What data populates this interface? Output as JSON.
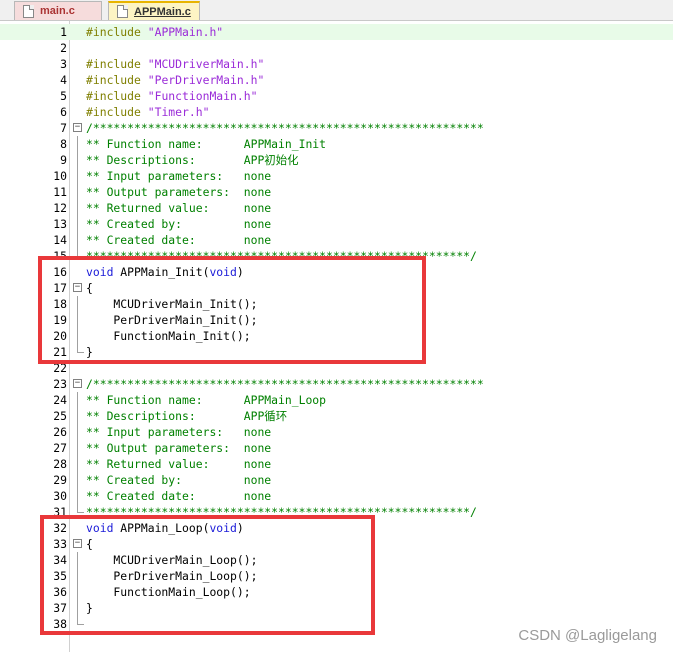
{
  "tabs": [
    {
      "label": "main.c",
      "active": false
    },
    {
      "label": "APPMain.c",
      "active": true
    }
  ],
  "lines": [
    {
      "n": "1",
      "html": "<span class=\"c-pre\">#include</span> <span class=\"c-str\">\"APPMain.h\"</span>",
      "hl": true
    },
    {
      "n": "2",
      "html": ""
    },
    {
      "n": "3",
      "html": "<span class=\"c-pre\">#include</span> <span class=\"c-str\">\"MCUDriverMain.h\"</span>"
    },
    {
      "n": "4",
      "html": "<span class=\"c-pre\">#include</span> <span class=\"c-str\">\"PerDriverMain.h\"</span>"
    },
    {
      "n": "5",
      "html": "<span class=\"c-pre\">#include</span> <span class=\"c-str\">\"FunctionMain.h\"</span>"
    },
    {
      "n": "6",
      "html": "<span class=\"c-pre\">#include</span> <span class=\"c-str\">\"Timer.h\"</span>"
    },
    {
      "n": "7",
      "html": "<span class=\"c-com\">/*********************************************************</span>",
      "fold": "open"
    },
    {
      "n": "8",
      "html": "<span class=\"c-com\">** Function name:      APPMain_Init</span>",
      "guide": true
    },
    {
      "n": "9",
      "html": "<span class=\"c-com\">** Descriptions:       APP初始化</span>",
      "guide": true
    },
    {
      "n": "10",
      "html": "<span class=\"c-com\">** Input parameters:   none</span>",
      "guide": true
    },
    {
      "n": "11",
      "html": "<span class=\"c-com\">** Output parameters:  none</span>",
      "guide": true
    },
    {
      "n": "12",
      "html": "<span class=\"c-com\">** Returned value:     none</span>",
      "guide": true
    },
    {
      "n": "13",
      "html": "<span class=\"c-com\">** Created by:         none</span>",
      "guide": true
    },
    {
      "n": "14",
      "html": "<span class=\"c-com\">** Created date:       none</span>",
      "guide": true
    },
    {
      "n": "15",
      "html": "<span class=\"c-com\">********************************************************/</span>",
      "guideEnd": true
    },
    {
      "n": "16",
      "html": "<span class=\"c-kw\">void</span> APPMain_Init(<span class=\"c-kw\">void</span>)"
    },
    {
      "n": "17",
      "html": "{",
      "fold": "open"
    },
    {
      "n": "18",
      "html": "    MCUDriverMain_Init();",
      "guide": true
    },
    {
      "n": "19",
      "html": "    PerDriverMain_Init();",
      "guide": true
    },
    {
      "n": "20",
      "html": "    FunctionMain_Init();",
      "guide": true
    },
    {
      "n": "21",
      "html": "}",
      "guideEnd": true
    },
    {
      "n": "22",
      "html": ""
    },
    {
      "n": "23",
      "html": "<span class=\"c-com\">/*********************************************************</span>",
      "fold": "open"
    },
    {
      "n": "24",
      "html": "<span class=\"c-com\">** Function name:      APPMain_Loop</span>",
      "guide": true
    },
    {
      "n": "25",
      "html": "<span class=\"c-com\">** Descriptions:       APP循环</span>",
      "guide": true
    },
    {
      "n": "26",
      "html": "<span class=\"c-com\">** Input parameters:   none</span>",
      "guide": true
    },
    {
      "n": "27",
      "html": "<span class=\"c-com\">** Output parameters:  none</span>",
      "guide": true
    },
    {
      "n": "28",
      "html": "<span class=\"c-com\">** Returned value:     none</span>",
      "guide": true
    },
    {
      "n": "29",
      "html": "<span class=\"c-com\">** Created by:         none</span>",
      "guide": true
    },
    {
      "n": "30",
      "html": "<span class=\"c-com\">** Created date:       none</span>",
      "guide": true
    },
    {
      "n": "31",
      "html": "<span class=\"c-com\">********************************************************/</span>",
      "guideEnd": true
    },
    {
      "n": "32",
      "html": "<span class=\"c-kw\">void</span> APPMain_Loop(<span class=\"c-kw\">void</span>)"
    },
    {
      "n": "33",
      "html": "{",
      "fold": "open"
    },
    {
      "n": "34",
      "html": "    MCUDriverMain_Loop();",
      "guide": true
    },
    {
      "n": "35",
      "html": "    PerDriverMain_Loop();",
      "guide": true
    },
    {
      "n": "36",
      "html": "    FunctionMain_Loop();",
      "guide": true
    },
    {
      "n": "37",
      "html": "}",
      "guide": true
    },
    {
      "n": "38",
      "html": "",
      "guideEnd": true
    }
  ],
  "watermark": "CSDN @Lagligelang",
  "colors": {
    "highlight_box": "#e9383a",
    "comment": "#008000",
    "keyword": "#1a1ad8",
    "string": "#9a2bd8"
  }
}
